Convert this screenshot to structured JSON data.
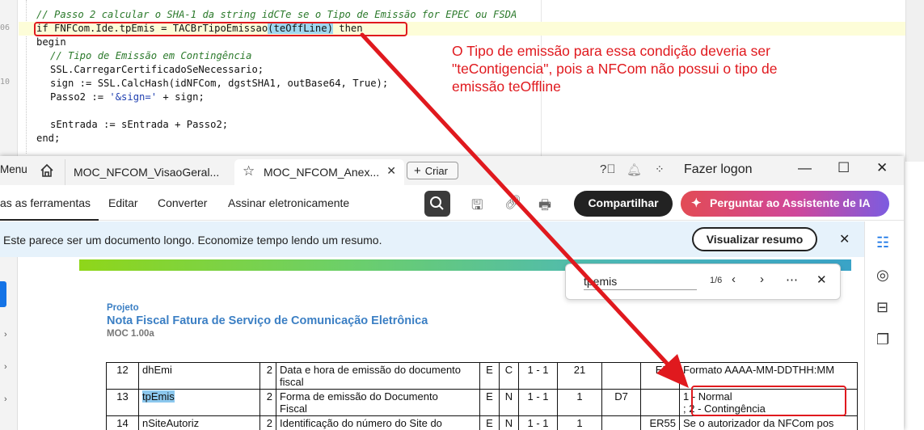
{
  "editor": {
    "gutter_numbers": [
      "06",
      "10"
    ],
    "lines": [
      {
        "comment": "// Passo 2 calcular o SHA-1 da string idCTe se o Tipo de Emissão for EPEC ou FSDA"
      },
      {
        "pre": "if FNFCom.Ide.tpEmis = TACBrTipoEmissao",
        "paren1": "(",
        "hl": "teOffLine",
        "paren2": ")",
        "post": " then"
      },
      {
        "text": "begin"
      },
      {
        "comment": "// Tipo de Emissão em Contingência"
      },
      {
        "text": "SSL.CarregarCertificadoSeNecessario;"
      },
      {
        "text": "sign := SSL.CalcHash(idNFCom, dgstSHA1, outBase64, True);"
      },
      {
        "pre": "Passo2 := ",
        "str": "'&sign='",
        "post": " + sign;"
      },
      {
        "text": ""
      },
      {
        "text": "sEntrada := sEntrada + Passo2;"
      },
      {
        "text": "end;"
      }
    ],
    "annotation": "O Tipo de emissão para essa condição deveria ser \"teContigencia\", pois a NFCom não possui o tipo de emissão teOffline"
  },
  "acrobat": {
    "menu_label": "Menu",
    "tabs": [
      {
        "label": "MOC_NFCOM_VisaoGeral..."
      },
      {
        "label": "MOC_NFCOM_Anex..."
      }
    ],
    "new_tab_label": "Criar",
    "signin_label": "Fazer logon",
    "toolbar": {
      "items": [
        "as as ferramentas",
        "Editar",
        "Converter",
        "Assinar eletronicamente"
      ],
      "share_label": "Compartilhar",
      "ai_label": "Perguntar ao Assistente de IA"
    },
    "banner": {
      "text": "Este parece ser um documento longo. Economize tempo lendo um resumo.",
      "button_label": "Visualizar resumo"
    },
    "find": {
      "query": "tpemis",
      "count": "1/6"
    },
    "document": {
      "project_label": "Projeto",
      "title": "Nota Fiscal Fatura de Serviço de Comunicação Eletrônica",
      "version": "MOC 1.00a"
    },
    "table_rows": [
      {
        "num": "12",
        "name": "dhEmi",
        "n": "2",
        "desc1": "Data e hora de emissão do documento",
        "desc2": "fiscal",
        "e": "E",
        "t": "C",
        "oc": "1 - 1",
        "tam": "21",
        "dec": "",
        "ref": "ER1",
        "obs1": "Formato AAAA-MM-DDTHH:MM",
        "obs2": ""
      },
      {
        "num": "13",
        "name": "tpEmis",
        "n": "2",
        "desc1": "Forma de emissão do Documento",
        "desc2": "Fiscal",
        "e": "E",
        "t": "N",
        "oc": "1 - 1",
        "tam": "1",
        "dec": "D7",
        "ref": "",
        "obs1": "1 - Normal",
        "obs2": "; 2 - Contingência"
      },
      {
        "num": "14",
        "name": "nSiteAutoriz",
        "n": "2",
        "desc1": "Identificação do número do Site do",
        "desc2": "",
        "e": "E",
        "t": "N",
        "oc": "1 - 1",
        "tam": "1",
        "dec": "",
        "ref": "ER55",
        "obs1": "Se o autorizador da NFCom pos",
        "obs2": ""
      }
    ]
  }
}
